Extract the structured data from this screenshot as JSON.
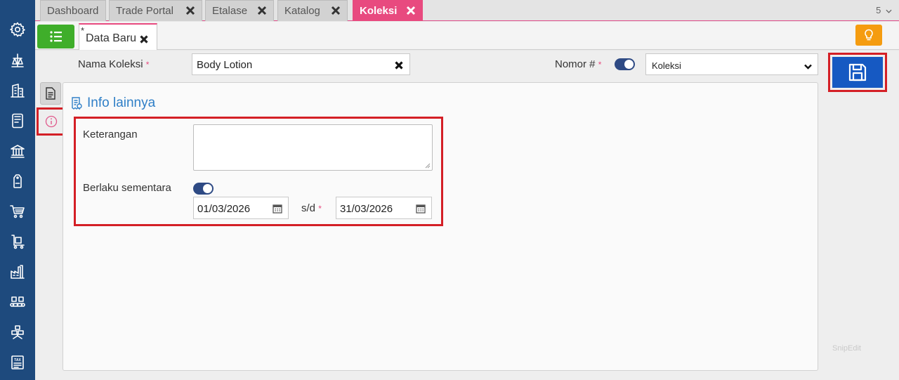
{
  "sidebar": {
    "icons": [
      "gear-icon",
      "scale-icon",
      "building-icon",
      "tablet-icon",
      "bank-icon",
      "tag-icon",
      "cart-icon",
      "trolley-icon",
      "factory-icon",
      "conveyor-icon",
      "boxes-icon",
      "tax-icon"
    ],
    "tax_label": "TAX"
  },
  "tabs": [
    {
      "label": "Dashboard",
      "closable": false,
      "active": false
    },
    {
      "label": "Trade Portal",
      "closable": true,
      "active": false
    },
    {
      "label": "Etalase",
      "closable": true,
      "active": false
    },
    {
      "label": "Katalog",
      "closable": true,
      "active": false
    },
    {
      "label": "Koleksi",
      "closable": true,
      "active": true
    }
  ],
  "tab_count": "5",
  "sub_tab": {
    "modified_mark": "*",
    "label": "Data Baru"
  },
  "form": {
    "nama_koleksi": {
      "label": "Nama Koleksi",
      "required_mark": "*",
      "value": "Body Lotion"
    },
    "nomor": {
      "label": "Nomor #",
      "required_mark": "*",
      "toggle_on": true,
      "selected": "Koleksi"
    }
  },
  "section": {
    "title": "Info lainnya",
    "keterangan": {
      "label": "Keterangan",
      "value": ""
    },
    "berlaku_sementara": {
      "label": "Berlaku sementara",
      "toggle_on": true
    },
    "date_from": "01/03/2026",
    "sd": {
      "label": "s/d",
      "required_mark": "*"
    },
    "date_to": "31/03/2026"
  },
  "watermark": "SnipEdit",
  "colors": {
    "sidebar": "#1e4a7d",
    "active_tab": "#e84a7f",
    "list_button": "#3fae2a",
    "bulb_button": "#f59c10",
    "save_button": "#1659c2",
    "highlight": "#d41f26",
    "section_title": "#2f7fc7",
    "toggle": "#2e4a84"
  }
}
